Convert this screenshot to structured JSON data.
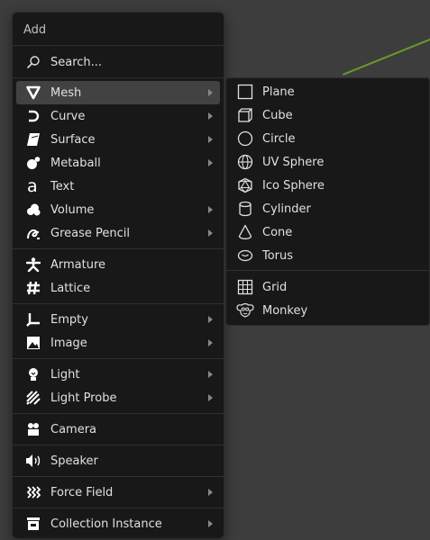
{
  "menu": {
    "title": "Add",
    "search_label": "Search...",
    "items": [
      {
        "label": "Mesh",
        "icon": "mesh-icon",
        "submenu": true,
        "highlighted": true
      },
      {
        "label": "Curve",
        "icon": "curve-icon",
        "submenu": true
      },
      {
        "label": "Surface",
        "icon": "surface-icon",
        "submenu": true
      },
      {
        "label": "Metaball",
        "icon": "metaball-icon",
        "submenu": true
      },
      {
        "label": "Text",
        "icon": "text-icon",
        "submenu": false
      },
      {
        "label": "Volume",
        "icon": "volume-icon",
        "submenu": true
      },
      {
        "label": "Grease Pencil",
        "icon": "grease-pencil-icon",
        "submenu": true
      },
      {
        "label": "Armature",
        "icon": "armature-icon",
        "submenu": false
      },
      {
        "label": "Lattice",
        "icon": "lattice-icon",
        "submenu": false
      },
      {
        "label": "Empty",
        "icon": "empty-icon",
        "submenu": true
      },
      {
        "label": "Image",
        "icon": "image-icon",
        "submenu": true
      },
      {
        "label": "Light",
        "icon": "light-icon",
        "submenu": true
      },
      {
        "label": "Light Probe",
        "icon": "light-probe-icon",
        "submenu": true
      },
      {
        "label": "Camera",
        "icon": "camera-icon",
        "submenu": false
      },
      {
        "label": "Speaker",
        "icon": "speaker-icon",
        "submenu": false
      },
      {
        "label": "Force Field",
        "icon": "force-field-icon",
        "submenu": true
      },
      {
        "label": "Collection Instance",
        "icon": "collection-instance-icon",
        "submenu": true
      }
    ]
  },
  "mesh_submenu": {
    "items": [
      {
        "label": "Plane",
        "icon": "plane-icon"
      },
      {
        "label": "Cube",
        "icon": "cube-icon"
      },
      {
        "label": "Circle",
        "icon": "circle-icon"
      },
      {
        "label": "UV Sphere",
        "icon": "uv-sphere-icon"
      },
      {
        "label": "Ico Sphere",
        "icon": "ico-sphere-icon"
      },
      {
        "label": "Cylinder",
        "icon": "cylinder-icon"
      },
      {
        "label": "Cone",
        "icon": "cone-icon"
      },
      {
        "label": "Torus",
        "icon": "torus-icon"
      },
      {
        "label": "Grid",
        "icon": "grid-icon"
      },
      {
        "label": "Monkey",
        "icon": "monkey-icon"
      }
    ]
  },
  "colors": {
    "viewport": "#3d3d3d",
    "menu_bg": "#181818",
    "highlight": "#424242",
    "text": "#e0e0e0",
    "grid_axis": "#6a9a2a"
  }
}
